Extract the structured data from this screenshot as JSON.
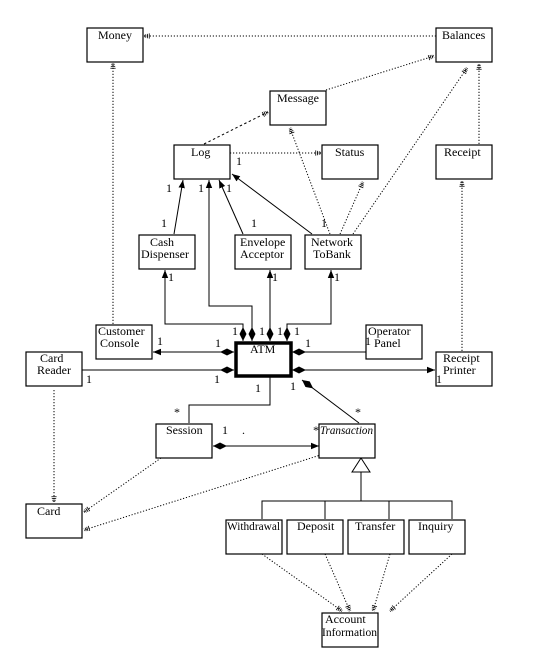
{
  "classes": {
    "money": [
      "Money"
    ],
    "balances": [
      "Balances"
    ],
    "message": [
      "Message"
    ],
    "log": [
      "Log"
    ],
    "status": [
      "Status"
    ],
    "receipt": [
      "Receipt"
    ],
    "cash_dispenser": [
      "Cash",
      "Dispenser"
    ],
    "envelope_acceptor": [
      "Envelope",
      "Acceptor"
    ],
    "network_to_bank": [
      "Network",
      "ToBank"
    ],
    "customer_console": [
      "Customer",
      "Console"
    ],
    "atm": [
      "ATM"
    ],
    "operator_panel": [
      "Operator",
      "Panel"
    ],
    "card_reader": [
      "Card",
      "Reader"
    ],
    "receipt_printer": [
      "Receipt",
      "Printer"
    ],
    "session": [
      "Session"
    ],
    "transaction": [
      "Transaction"
    ],
    "card": [
      "Card"
    ],
    "withdrawal": [
      "Withdrawal"
    ],
    "deposit": [
      "Deposit"
    ],
    "transfer": [
      "Transfer"
    ],
    "inquiry": [
      "Inquiry"
    ],
    "account_information": [
      "Account",
      "Information"
    ]
  },
  "multiplicities": [
    "1",
    "1",
    "1",
    "1",
    "1",
    "1",
    "1",
    "1",
    "1",
    "1",
    "1",
    "1",
    "1",
    "1",
    "1",
    "1",
    "1",
    "1",
    "1",
    "1",
    "1",
    "1",
    "1",
    "1",
    "1",
    "*",
    "1",
    "*",
    "*",
    "1"
  ],
  "stray_mark": "."
}
